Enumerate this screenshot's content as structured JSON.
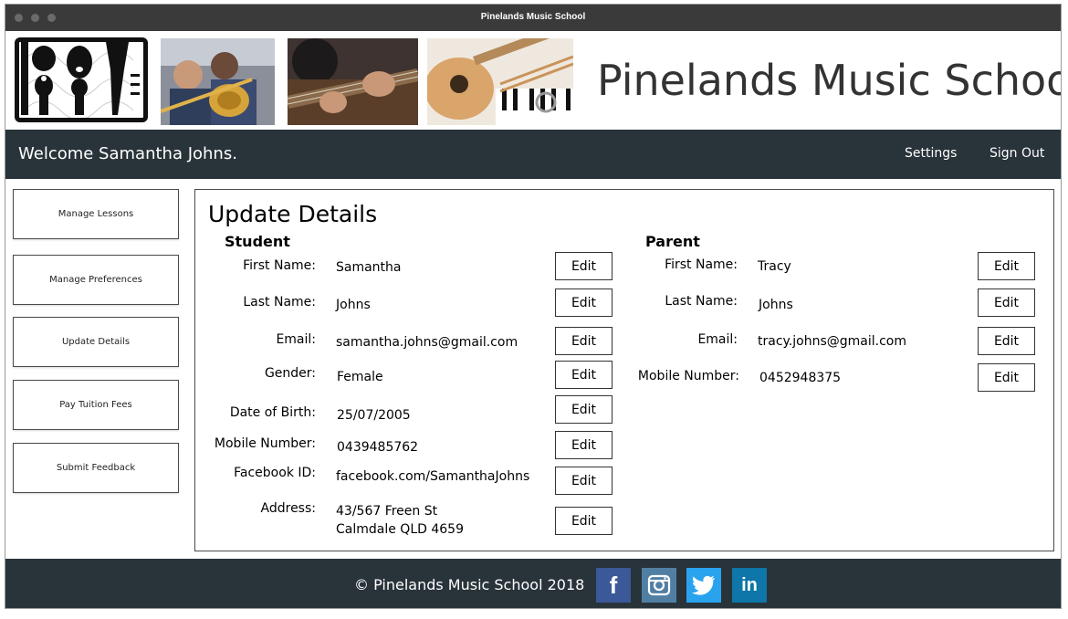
{
  "window": {
    "title": "Pinelands Music School"
  },
  "header": {
    "site_title": "Pinelands Music School"
  },
  "nav": {
    "welcome": "Welcome Samantha Johns.",
    "settings": "Settings",
    "sign_out": "Sign Out"
  },
  "sidebar": {
    "items": [
      {
        "label": "Manage Lessons"
      },
      {
        "label": "Manage Preferences"
      },
      {
        "label": "Update Details"
      },
      {
        "label": "Pay Tuition Fees"
      },
      {
        "label": "Submit Feedback"
      }
    ]
  },
  "main": {
    "title": "Update Details",
    "edit_label": "Edit",
    "student": {
      "heading": "Student",
      "fields": [
        {
          "label": "First Name:",
          "value": "Samantha"
        },
        {
          "label": "Last Name:",
          "value": "Johns"
        },
        {
          "label": "Email:",
          "value": "samantha.johns@gmail.com"
        },
        {
          "label": "Gender:",
          "value": "Female"
        },
        {
          "label": "Date of Birth:",
          "value": "25/07/2005"
        },
        {
          "label": "Mobile Number:",
          "value": "0439485762"
        },
        {
          "label": "Facebook ID:",
          "value": "facebook.com/SamanthaJohns"
        },
        {
          "label": "Address:",
          "value_line1": "43/567 Freen St",
          "value_line2": "Calmdale QLD 4659"
        }
      ]
    },
    "parent": {
      "heading": "Parent",
      "fields": [
        {
          "label": "First Name:",
          "value": "Tracy"
        },
        {
          "label": "Last Name:",
          "value": "Johns"
        },
        {
          "label": "Email:",
          "value": "tracy.johns@gmail.com"
        },
        {
          "label": "Mobile Number:",
          "value": "0452948375"
        }
      ]
    }
  },
  "footer": {
    "copyright": "© Pinelands Music School   2018",
    "social": [
      {
        "icon": "facebook-icon",
        "glyph": "f",
        "color": "#3b5998"
      },
      {
        "icon": "instagram-icon",
        "glyph": "",
        "color": "#517fa4"
      },
      {
        "icon": "twitter-icon",
        "glyph": "",
        "color": "#2aa3ef"
      },
      {
        "icon": "linkedin-icon",
        "glyph": "in",
        "color": "#0e76a8"
      }
    ]
  },
  "colors": {
    "dark_bar": "#29333a",
    "titlebar": "#3a3a3a"
  }
}
